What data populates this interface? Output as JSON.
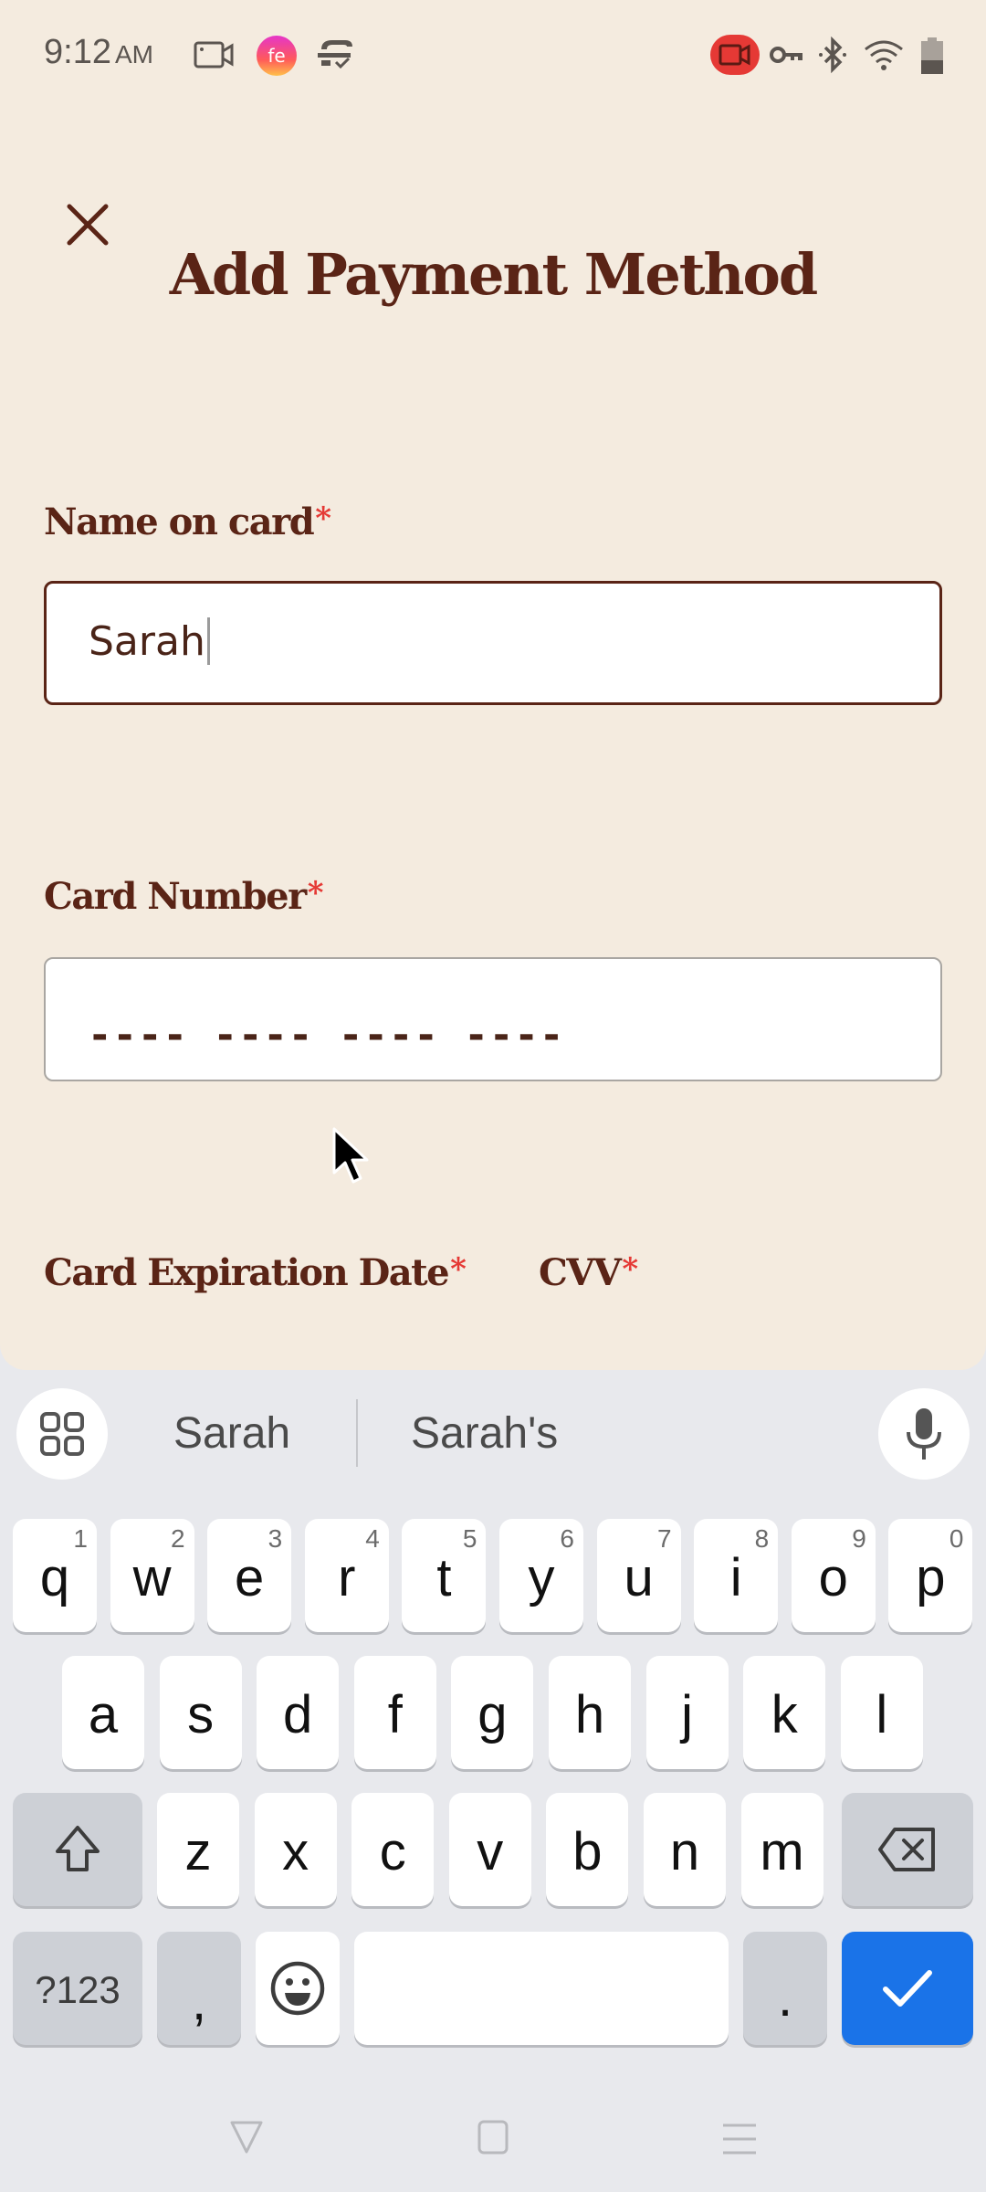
{
  "status_bar": {
    "time": "9:12",
    "ampm": "AM",
    "left_icons": [
      "screen-record-icon",
      "app-notification-icon",
      "sync-check-icon"
    ],
    "right_icons": [
      "recording-active-icon",
      "vpn-key-icon",
      "bluetooth-icon",
      "wifi-icon",
      "battery-icon"
    ],
    "recording_color": "#e53935"
  },
  "sheet": {
    "title": "Add Payment Method",
    "close_icon": "close-icon",
    "fields": {
      "name": {
        "label": "Name on card",
        "required_mark": "*",
        "value": "Sarah",
        "focused": true
      },
      "card_number": {
        "label": "Card Number",
        "required_mark": "*",
        "placeholder": "---- ---- ---- ----"
      },
      "expiration": {
        "label": "Card Expiration Date",
        "required_mark": "*"
      },
      "cvv": {
        "label": "CVV",
        "required_mark": "*"
      }
    },
    "colors": {
      "text": "#5a2416",
      "background": "#f4ebdf",
      "required": "#e53935"
    }
  },
  "keyboard": {
    "suggestions": [
      "Sarah",
      "Sarah's"
    ],
    "apps_icon": "apps-grid-icon",
    "mic_icon": "microphone-icon",
    "row1": [
      {
        "key": "q",
        "hint": "1"
      },
      {
        "key": "w",
        "hint": "2"
      },
      {
        "key": "e",
        "hint": "3"
      },
      {
        "key": "r",
        "hint": "4"
      },
      {
        "key": "t",
        "hint": "5"
      },
      {
        "key": "y",
        "hint": "6"
      },
      {
        "key": "u",
        "hint": "7"
      },
      {
        "key": "i",
        "hint": "8"
      },
      {
        "key": "o",
        "hint": "9"
      },
      {
        "key": "p",
        "hint": "0"
      }
    ],
    "row2": [
      "a",
      "s",
      "d",
      "f",
      "g",
      "h",
      "j",
      "k",
      "l"
    ],
    "row3": [
      "z",
      "x",
      "c",
      "v",
      "b",
      "n",
      "m"
    ],
    "symbols_label": "?123",
    "comma_label": ",",
    "period_label": ".",
    "action_color": "#1a73e8"
  },
  "nav_bar": {
    "buttons": [
      "back-icon",
      "home-icon",
      "recents-icon"
    ]
  }
}
